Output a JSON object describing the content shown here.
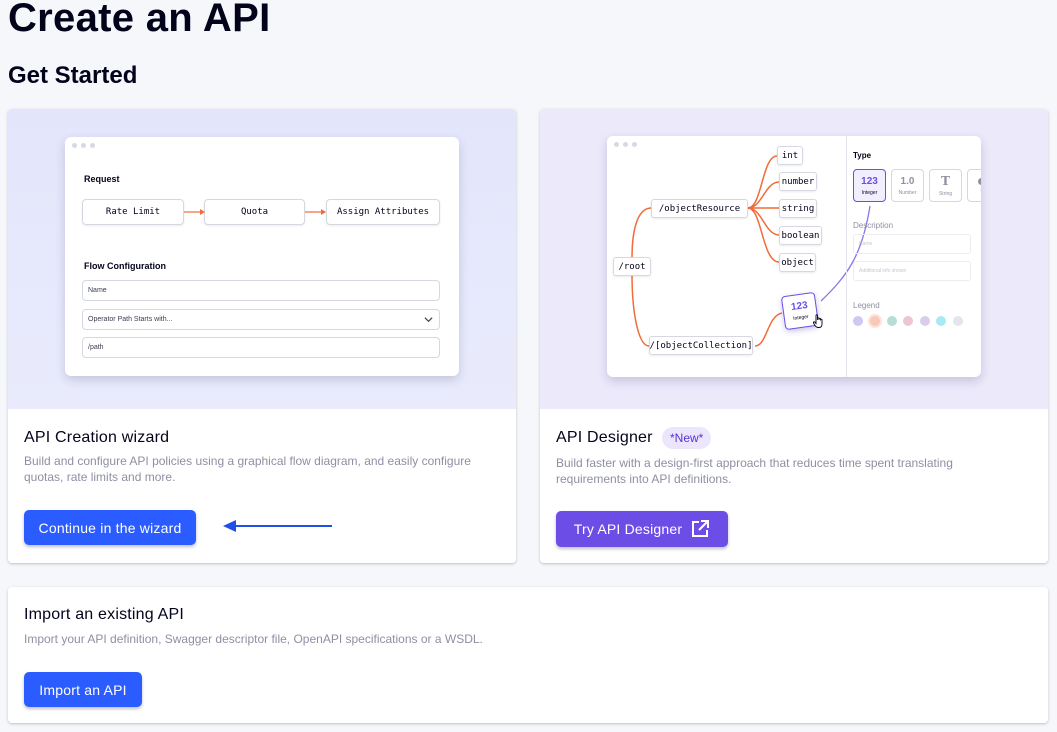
{
  "page": {
    "title": "Create an API",
    "section_title": "Get Started"
  },
  "wizard_card": {
    "heading": "API Creation wizard",
    "description": "Build and configure API policies using a graphical flow diagram, and easily configure quotas, rate limits and more.",
    "button_label": "Continue in the wizard",
    "illustration": {
      "request_label": "Request",
      "flow_steps": [
        "Rate Limit",
        "Quota",
        "Assign Attributes"
      ],
      "flow_config_label": "Flow Configuration",
      "inputs": {
        "name": "Name",
        "operator": "Operator Path Starts with...",
        "path": "/path"
      }
    }
  },
  "designer_card": {
    "heading": "API Designer",
    "badge": "*New*",
    "description": "Build faster with a design-first approach that reduces time spent translating requirements into API definitions.",
    "button_label": "Try API Designer",
    "button_icon": "external-link-icon",
    "illustration": {
      "root": "/root",
      "object_resource": "/objectResource",
      "object_collection": "/[objectCollection]",
      "types": [
        "int",
        "number",
        "string",
        "boolean",
        "object"
      ],
      "dragged_tile": {
        "value": "123",
        "label": "Integer"
      },
      "panel": {
        "type_label": "Type",
        "tiles": [
          {
            "value": "123",
            "label": "Integer"
          },
          {
            "value": "1.0",
            "label": "Number"
          },
          {
            "value": "T",
            "label": "String"
          },
          {
            "value": "",
            "label": "Bo"
          }
        ],
        "description_label": "Description",
        "name_placeholder": "Name",
        "description_placeholder": "Additional info shown",
        "legend_label": "Legend"
      },
      "legend_colors": [
        "#cfc8f3",
        "#f8c8b8",
        "#b5dfd5",
        "#eec5d2",
        "#d9cdee",
        "#a9e9f5",
        "#e4e5eb"
      ]
    }
  },
  "import_card": {
    "heading": "Import an existing API",
    "description": "Import your API definition, Swagger descriptor file, OpenAPI specifications or a WSDL.",
    "button_label": "Import an API"
  },
  "colors": {
    "primary_blue": "#2b5cff",
    "designer_purple": "#6c4de6",
    "arrow_blue": "#1f4fe8",
    "flow_orange": "#f26b3a"
  }
}
